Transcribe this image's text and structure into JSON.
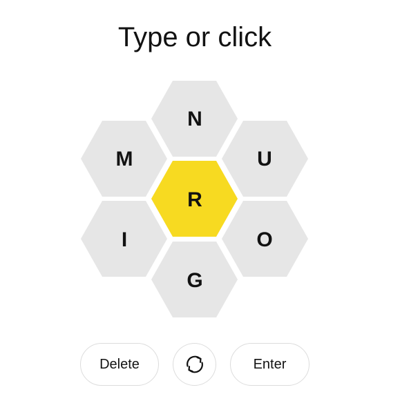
{
  "prompt": "Type or click",
  "letters": {
    "center": "R",
    "top": "N",
    "upper_left": "M",
    "upper_right": "U",
    "lower_left": "I",
    "lower_right": "O",
    "bottom": "G"
  },
  "buttons": {
    "delete": "Delete",
    "shuffle_icon": "shuffle-icon",
    "enter": "Enter"
  },
  "colors": {
    "center_cell": "#f7da21",
    "outer_cell": "#e6e6e6",
    "text": "#121212"
  }
}
